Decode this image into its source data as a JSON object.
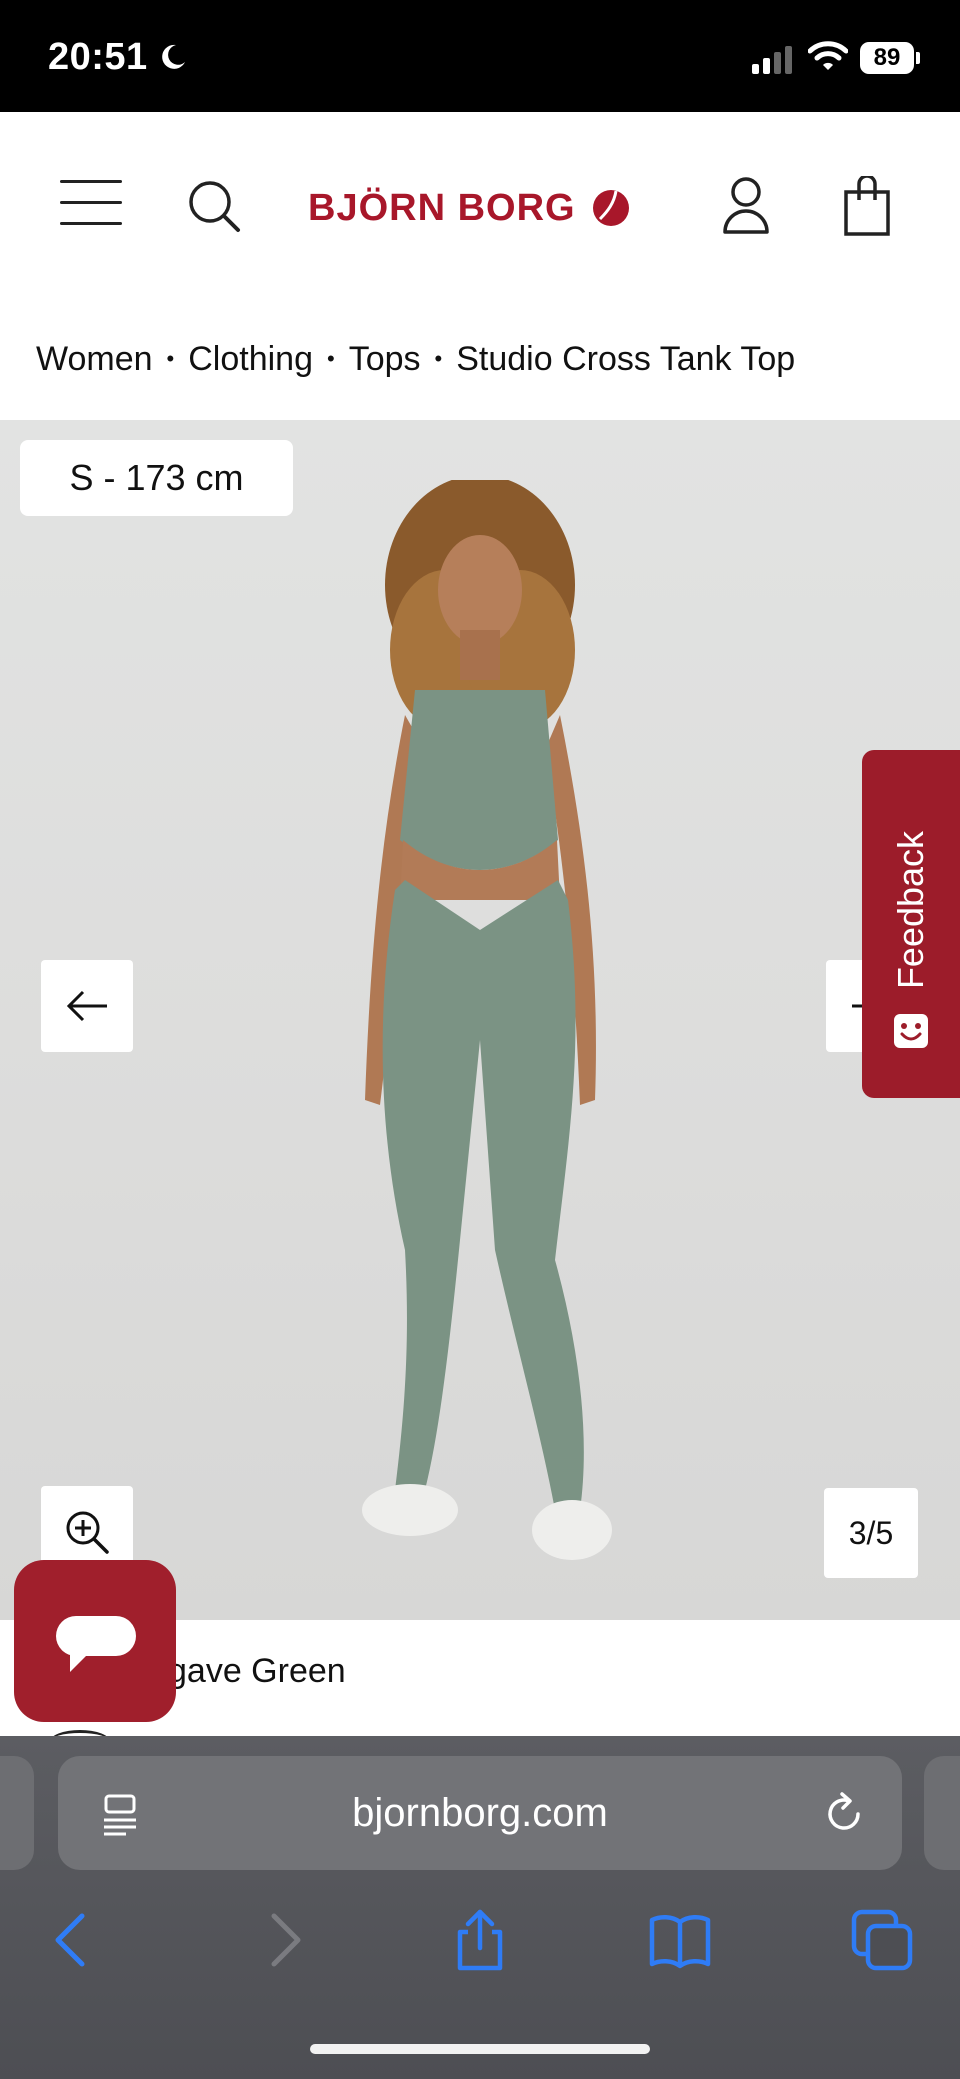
{
  "status_bar": {
    "time": "20:51",
    "battery": "89",
    "icons": [
      "moon-icon",
      "signal-icon",
      "wifi-icon",
      "battery-icon"
    ]
  },
  "header": {
    "brand": "BJÖRN BORG",
    "brand_color": "#a8172a",
    "icons": [
      "menu-icon",
      "search-icon",
      "account-icon",
      "cart-icon"
    ]
  },
  "breadcrumb": {
    "items": [
      "Women",
      "Clothing",
      "Tops",
      "Studio Cross Tank Top"
    ],
    "separator": "•"
  },
  "gallery": {
    "size_badge": "S - 173 cm",
    "counter": "3/5",
    "background": "#dddddc",
    "garment_color": "#7b9384"
  },
  "feedback": {
    "label": "Feedback",
    "color": "#9c1c2a"
  },
  "product": {
    "color_name_visible": "gave Green"
  },
  "browser": {
    "url": "bjornborg.com",
    "accent": "#2f7cf6",
    "toolbar": [
      "back-icon",
      "forward-icon",
      "share-icon",
      "bookmarks-icon",
      "tabs-icon"
    ]
  }
}
